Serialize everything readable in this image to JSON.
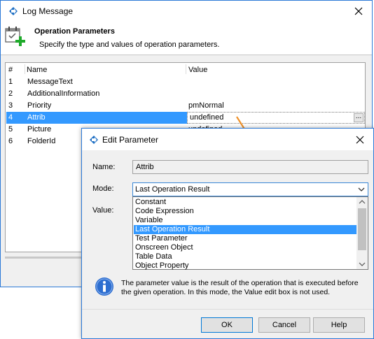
{
  "main_window": {
    "title": "Log Message",
    "header": {
      "title": "Operation Parameters",
      "subtitle": "Specify the type and values of operation parameters."
    },
    "table": {
      "columns": [
        "#",
        "Name",
        "Value"
      ],
      "rows": [
        {
          "num": "1",
          "name": "MessageText",
          "value": ""
        },
        {
          "num": "2",
          "name": "AdditionalInformation",
          "value": ""
        },
        {
          "num": "3",
          "name": "Priority",
          "value": "pmNormal"
        },
        {
          "num": "4",
          "name": "Attrib",
          "value": "undefined",
          "selected": true
        },
        {
          "num": "5",
          "name": "Picture",
          "value": "undefined"
        },
        {
          "num": "6",
          "name": "FolderId",
          "value": ""
        }
      ],
      "ellipsis": "..."
    }
  },
  "edit_dialog": {
    "title": "Edit Parameter",
    "name_label": "Name:",
    "name_value": "Attrib",
    "mode_label": "Mode:",
    "mode_value": "Last Operation Result",
    "value_label": "Value:",
    "mode_options": [
      "Constant",
      "Code Expression",
      "Variable",
      "Last Operation Result",
      "Test Parameter",
      "Onscreen Object",
      "Table Data",
      "Object Property"
    ],
    "highlighted_option": "Last Operation Result",
    "info_text": "The parameter value is the result of the operation that is executed before the given operation. In this mode, the Value edit box is not used.",
    "buttons": {
      "ok": "OK",
      "cancel": "Cancel",
      "help": "Help"
    }
  },
  "colors": {
    "accent": "#2b79d7",
    "selection": "#3399ff",
    "arrow": "#f0922a"
  }
}
